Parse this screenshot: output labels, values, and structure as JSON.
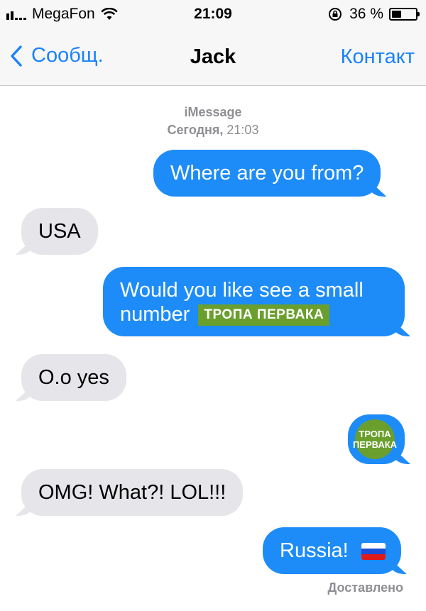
{
  "status_bar": {
    "carrier": "MegaFon",
    "time": "21:09",
    "battery_text": "36 %",
    "battery_level": 0.36,
    "signal_bars_filled": 2,
    "signal_bars_total": 5
  },
  "nav": {
    "back_label": "Сообщ.",
    "title": "Jack",
    "contact_label": "Контакт"
  },
  "thread": {
    "service": "iMessage",
    "date_day": "Сегодня,",
    "date_time": "21:03",
    "messages": [
      {
        "direction": "outgoing",
        "text": "Where are you from?"
      },
      {
        "direction": "incoming",
        "text": "USA"
      },
      {
        "direction": "outgoing",
        "text_line1": "Would you like see a small",
        "text_line2": "number",
        "badge": "ТРОПА ПЕРВАКА"
      },
      {
        "direction": "incoming",
        "text": "O.o yes"
      },
      {
        "direction": "outgoing",
        "sticker_line1": "ТРОПА",
        "sticker_line2": "ПЕРВАКА"
      },
      {
        "direction": "incoming",
        "text": "OMG! What?! LOL!!!"
      },
      {
        "direction": "outgoing",
        "text": "Russia!",
        "emoji": "russian-flag"
      }
    ],
    "delivery_status": "Доставлено"
  },
  "colors": {
    "accent": "#1a82fb",
    "outgoing_bubble": "#1d8cf8",
    "incoming_bubble": "#e5e5ea",
    "badge_green": "#6a9f2e",
    "meta_gray": "#8e8e93"
  }
}
